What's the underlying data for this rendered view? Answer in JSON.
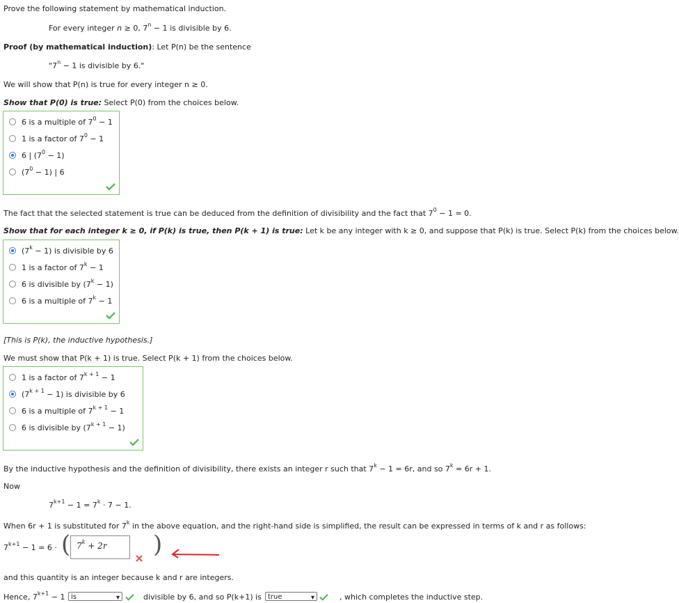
{
  "intro": "Prove the following statement by mathematical induction.",
  "statement": {
    "prefix": "For every integer",
    "var": "n",
    "rel": "≥ 0, 7",
    "sup": "n",
    "suffix": " − 1 is divisible by 6."
  },
  "proof": {
    "heading": "Proof (by mathematical induction)",
    "text": ": Let P(n) be the sentence",
    "sentence_a": "\"7",
    "sentence_sup": "n",
    "sentence_b": " − 1 is divisible by 6.\"",
    "show_all": "We will show that P(n) is true for every integer n ≥ 0."
  },
  "base": {
    "prompt_head": "Show that P(0) is true:",
    "prompt_tail": " Select P(0) from the choices below.",
    "options": [
      {
        "a": "6 is a multiple of 7",
        "sup": "0",
        "b": " − 1"
      },
      {
        "a": "1 is a factor of 7",
        "sup": "0",
        "b": " − 1"
      },
      {
        "a": "6 | (7",
        "sup": "0",
        "b": " − 1)"
      },
      {
        "a": "(7",
        "sup": "0",
        "b": " − 1) | 6"
      }
    ],
    "selected": 2,
    "fact_a": "The fact that the selected statement is true can be deduced from the definition of divisibility and the fact that 7",
    "fact_sup": "0",
    "fact_b": " − 1 = 0."
  },
  "step": {
    "prompt_head": "Show that for each integer k ≥ 0, if P(k) is true, then P(k + 1) is true:",
    "prompt_tail": " Let k be any integer with k ≥ 0, and suppose that P(k) is true. Select P(k) from the choices below.",
    "options": [
      {
        "a": "(7",
        "sup": "k",
        "b": " − 1) is divisible by 6"
      },
      {
        "a": "1 is a factor of 7",
        "sup": "k",
        "b": " − 1"
      },
      {
        "a": "6 is divisible by (7",
        "sup": "k",
        "b": " − 1)"
      },
      {
        "a": "6 is a multiple of 7",
        "sup": "k",
        "b": " − 1"
      }
    ],
    "selected": 0,
    "hypothesis_note": "[This is P(k), the inductive hypothesis.]",
    "must_show": "We must show that P(k + 1) is true. Select P(k + 1) from the choices below.",
    "options2": [
      {
        "a": "1 is a factor of 7",
        "sup": "k + 1",
        "b": " − 1"
      },
      {
        "a": "(7",
        "sup": "k + 1",
        "b": " − 1) is divisible by 6"
      },
      {
        "a": "6 is a multiple of 7",
        "sup": "k + 1",
        "b": " − 1"
      },
      {
        "a": "6 is divisible by (7",
        "sup": "k + 1",
        "b": " − 1)"
      }
    ],
    "selected2": 1
  },
  "derivation": {
    "hyp_a": "By the inductive hypothesis and the definition of divisibility, there exists an integer r such that 7",
    "hyp_sup1": "k",
    "hyp_b": " − 1 = 6r, and so 7",
    "hyp_sup2": "k",
    "hyp_c": " = 6r + 1.",
    "now": "Now",
    "eq_a": "7",
    "eq_sup": "k+1",
    "eq_b": " − 1 = 7",
    "eq_sup2": "k",
    "eq_c": " · 7 − 1.",
    "subst_a": "When 6r + 1 is substituted for 7",
    "subst_sup": "k",
    "subst_b": " in the above equation, and the right-hand side is simplified, the result can be expressed in terms of k and r as follows:",
    "lhs_a": "7",
    "lhs_sup": "k+1",
    "lhs_b": " − 1 = 6 ·",
    "answer_base": "7",
    "answer_sup": "k",
    "answer_tail": " + 2r",
    "integer_note": "and this quantity is an integer because k and r are integers.",
    "hence_a": "Hence, 7",
    "hence_sup": "k+1",
    "hence_b": " − 1",
    "select1_value": "is",
    "mid": "divisible by 6, and so P(k+1) is",
    "select2_value": "true",
    "end": ", which completes the inductive step."
  },
  "colors": {
    "correct": "#5cb85c",
    "incorrect": "#e05555",
    "annotation_arrow": "#d9252a",
    "box_border": "#7bc46b"
  }
}
